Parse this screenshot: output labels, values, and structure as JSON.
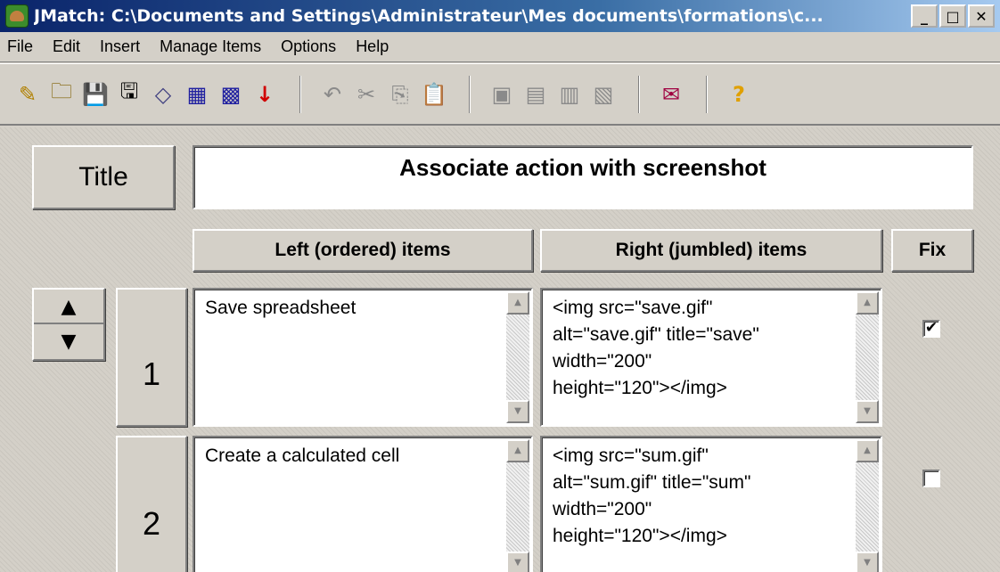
{
  "window": {
    "title": "JMatch: C:\\Documents and Settings\\Administrateur\\Mes documents\\formations\\c...",
    "minimize": "_",
    "maximize": "□",
    "close": "✕"
  },
  "menu": [
    "File",
    "Edit",
    "Insert",
    "Manage Items",
    "Options",
    "Help"
  ],
  "toolbar": {
    "icons": [
      "new-file-icon",
      "open-folder-icon",
      "save-icon",
      "save-as-icon",
      "eraser-icon",
      "web-page-icon",
      "web-page-alt-icon",
      "export-icon",
      "undo-icon",
      "cut-icon",
      "copy-icon",
      "paste-icon",
      "config-icon",
      "exercise-icon",
      "advanced-icon",
      "options-icon",
      "add-text-icon",
      "help-icon"
    ],
    "glyphs": [
      "✎",
      "🗀",
      "💾",
      "🖫",
      "◇",
      "▦",
      "▩",
      "↓",
      "↶",
      "✂",
      "⎘",
      "📋",
      "▣",
      "▤",
      "▥",
      "▧",
      "✉",
      "?"
    ]
  },
  "form": {
    "title_label": "Title",
    "title_value": "Associate action with screenshot",
    "headers": {
      "left": "Left (ordered) items",
      "right": "Right (jumbled) items",
      "fix": "Fix"
    },
    "rows": [
      {
        "number": "1",
        "left": "Save spreadsheet",
        "right": "<img src=\"save.gif\"\nalt=\"save.gif\" title=\"save\"\nwidth=\"200\"\nheight=\"120\"></img>",
        "fix": true,
        "fix_mark": "✔"
      },
      {
        "number": "2",
        "left": "Create a calculated cell",
        "right": "<img src=\"sum.gif\"\nalt=\"sum.gif\" title=\"sum\"\nwidth=\"200\"\nheight=\"120\"></img>",
        "fix": false,
        "fix_mark": ""
      }
    ]
  },
  "colors": {
    "window_bg": "#d4d0c8",
    "title_bar_start": "#0a246a",
    "title_bar_end": "#a6caf0"
  }
}
